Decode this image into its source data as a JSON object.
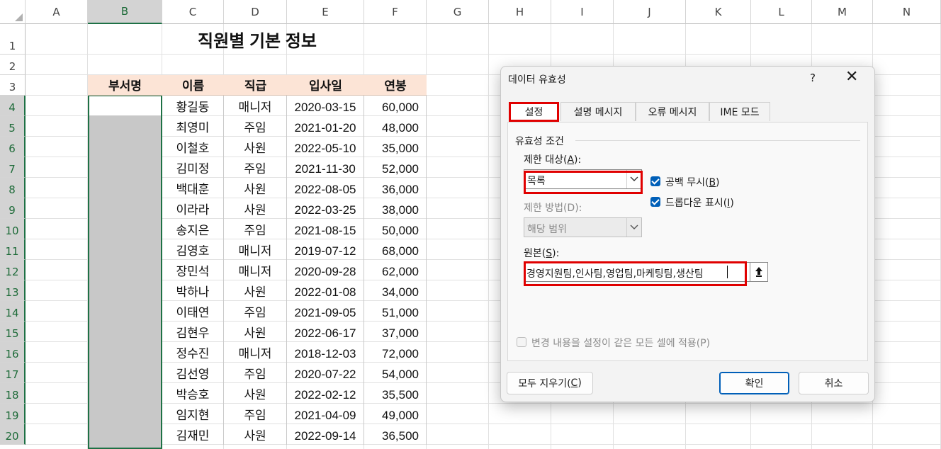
{
  "sheet": {
    "columns": [
      "A",
      "B",
      "C",
      "D",
      "E",
      "F",
      "G",
      "H",
      "I",
      "J",
      "K",
      "L",
      "M",
      "N"
    ],
    "rows": [
      "1",
      "2",
      "3",
      "4",
      "5",
      "6",
      "7",
      "8",
      "9",
      "10",
      "11",
      "12",
      "13",
      "14",
      "15",
      "16",
      "17",
      "18",
      "19",
      "20"
    ],
    "title": "직원별 기본 정보",
    "table_headers": [
      "부서명",
      "이름",
      "직급",
      "입사일",
      "연봉"
    ],
    "data": [
      [
        "황길동",
        "매니저",
        "2020-03-15",
        "60,000"
      ],
      [
        "최영미",
        "주임",
        "2021-01-20",
        "48,000"
      ],
      [
        "이철호",
        "사원",
        "2022-05-10",
        "35,000"
      ],
      [
        "김미정",
        "주임",
        "2021-11-30",
        "52,000"
      ],
      [
        "백대훈",
        "사원",
        "2022-08-05",
        "36,000"
      ],
      [
        "이라라",
        "사원",
        "2022-03-25",
        "38,000"
      ],
      [
        "송지은",
        "주임",
        "2021-08-15",
        "50,000"
      ],
      [
        "김영호",
        "매니저",
        "2019-07-12",
        "68,000"
      ],
      [
        "장민석",
        "매니저",
        "2020-09-28",
        "62,000"
      ],
      [
        "박하나",
        "사원",
        "2022-01-08",
        "34,000"
      ],
      [
        "이태연",
        "주임",
        "2021-09-05",
        "51,000"
      ],
      [
        "김현우",
        "사원",
        "2022-06-17",
        "37,000"
      ],
      [
        "정수진",
        "매니저",
        "2018-12-03",
        "72,000"
      ],
      [
        "김선영",
        "주임",
        "2020-07-22",
        "54,000"
      ],
      [
        "박승호",
        "사원",
        "2022-02-12",
        "35,500"
      ],
      [
        "임지현",
        "주임",
        "2021-04-09",
        "49,000"
      ],
      [
        "김재민",
        "사원",
        "2022-09-14",
        "36,500"
      ]
    ]
  },
  "dialog": {
    "title": "데이터 유효성",
    "help": "?",
    "close": "✕",
    "tabs": [
      "설정",
      "설명 메시지",
      "오류 메시지",
      "IME 모드"
    ],
    "group_label": "유효성 조건",
    "allow_label_prefix": "제한 대상(",
    "allow_label_key": "A",
    "allow_label_suffix": "):",
    "allow_value": "목록",
    "data_label": "제한 방법(D):",
    "data_value": "해당 범위",
    "ignore_blank_prefix": "공백 무시(",
    "ignore_blank_key": "B",
    "ignore_blank_suffix": ")",
    "dropdown_prefix": "드롭다운 표시(",
    "dropdown_key": "I",
    "dropdown_suffix": ")",
    "source_label_prefix": "원본(",
    "source_label_key": "S",
    "source_label_suffix": "):",
    "source_value": "경영지원팀,인사팀,영업팀,마케팅팀,생산팀",
    "apply_all_label": "변경 내용을 설정이 같은 모든 셀에 적용(P)",
    "clear_all_prefix": "모두 지우기(",
    "clear_all_key": "C",
    "clear_all_suffix": ")",
    "ok_label": "확인",
    "cancel_label": "취소"
  },
  "colors": {
    "header_fill": "#fce4d6",
    "selection_border": "#1e7145",
    "highlight_red": "#e00000",
    "checkbox_blue": "#005fb8"
  }
}
